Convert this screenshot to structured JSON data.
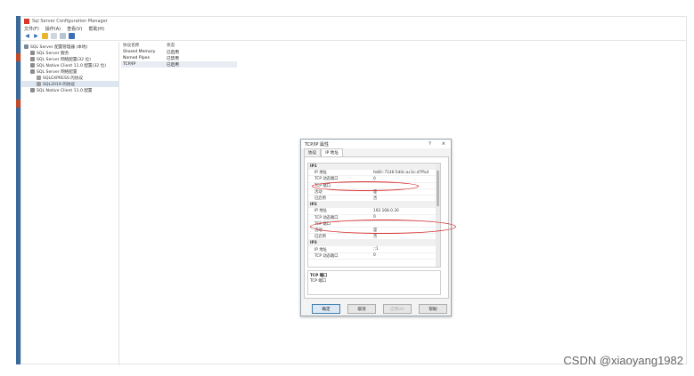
{
  "window": {
    "title": "Sql Server Configuration Manager"
  },
  "menu": {
    "items": [
      "文件(F)",
      "操作(A)",
      "查看(V)",
      "帮助(H)"
    ]
  },
  "tree": {
    "items": [
      {
        "label": "SQL Server 配置管理器 (本地)",
        "indent": 0,
        "color": "#7a8a9a"
      },
      {
        "label": "SQL Server 服务",
        "indent": 1,
        "color": "#8c8c8c"
      },
      {
        "label": "SQL Server 网络配置(32 位)",
        "indent": 1,
        "color": "#8c8c8c"
      },
      {
        "label": "SQL Native Client 11.0 配置(32 位)",
        "indent": 1,
        "color": "#8c8c8c"
      },
      {
        "label": "SQL Server 网络配置",
        "indent": 1,
        "color": "#8c8c8c"
      },
      {
        "label": "SQLEXPRESS 的协议",
        "indent": 2,
        "color": "#9c9c9c"
      },
      {
        "label": "SQL2019 的协议",
        "indent": 2,
        "color": "#9c9c9c",
        "selected": true
      },
      {
        "label": "SQL Native Client 11.0 配置",
        "indent": 1,
        "color": "#8c8c8c"
      }
    ]
  },
  "list": {
    "headers": [
      "协议名称",
      "状态"
    ],
    "rows": [
      {
        "name": "Shared Memory",
        "status": "已启用"
      },
      {
        "name": "Named Pipes",
        "status": "已禁用"
      },
      {
        "name": "TCP/IP",
        "status": "已启用",
        "selected": true
      }
    ]
  },
  "dialog": {
    "title": "TCP/IP 属性",
    "help": "?",
    "close": "×",
    "tabs": [
      "协议",
      "IP 地址"
    ],
    "rows": [
      {
        "section": true,
        "key": "IP1",
        "value": ""
      },
      {
        "key": "IP 地址",
        "value": "fe80::7146:5d0c:ac3c:d7f%4"
      },
      {
        "key": "TCP 动态端口",
        "value": "0"
      },
      {
        "key": "TCP 端口",
        "value": ""
      },
      {
        "key": "活动",
        "value": "是"
      },
      {
        "key": "已启用",
        "value": "否"
      },
      {
        "section": true,
        "key": "IP2",
        "value": ""
      },
      {
        "key": "IP 地址",
        "value": "192.168.0.30"
      },
      {
        "key": "TCP 动态端口",
        "value": "0"
      },
      {
        "key": "TCP 端口",
        "value": ""
      },
      {
        "key": "活动",
        "value": "是"
      },
      {
        "key": "已启用",
        "value": "否"
      },
      {
        "section": true,
        "key": "IP3",
        "value": ""
      },
      {
        "key": "IP 地址",
        "value": "::1"
      },
      {
        "key": "TCP 动态端口",
        "value": "0"
      }
    ],
    "description": {
      "title": "TCP 端口",
      "text": "TCP 端口"
    },
    "buttons": {
      "ok": "确定",
      "cancel": "取消",
      "apply": "应用(A)",
      "help": "帮助"
    }
  },
  "watermark": "CSDN @xiaoyang1982",
  "colors": {
    "highlight_ring": "#d62a2a",
    "primary_button": "#3c7fb1"
  }
}
